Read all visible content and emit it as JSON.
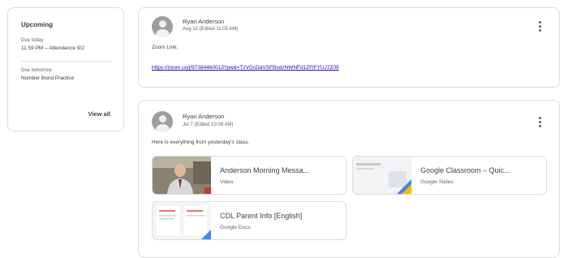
{
  "upcoming": {
    "title": "Upcoming",
    "items": [
      {
        "due": "Due today",
        "name": "11:59 PM – Attendance 9/2"
      },
      {
        "due": "Due tomorrow",
        "name": "Number Bond Practice"
      }
    ],
    "view_all": "View all"
  },
  "posts": [
    {
      "author": "Ryan Anderson",
      "date": "Aug 12 (Edited 11:05 AM)",
      "text": "Zoom Link:",
      "link": "https://zoom.us/j/97384460013?pwd=TzVGcDaVSFBvdzNWNFd1ZFlFYUJ7Z09"
    },
    {
      "author": "Ryan Anderson",
      "date": "Jul 7 (Edited 10:09 AM)",
      "text": "Here is everything from yesterday's class.",
      "attachments": [
        {
          "title": "Anderson Morning Messa...",
          "type": "Video",
          "thumb": "video-thumbnail"
        },
        {
          "title": "Google Classroom – Quic...",
          "type": "Google Slides",
          "thumb": "slides-thumbnail"
        },
        {
          "title": "CDL Parent Info [English]",
          "type": "Google Docs",
          "thumb": "docs-thumbnail"
        }
      ]
    }
  ]
}
